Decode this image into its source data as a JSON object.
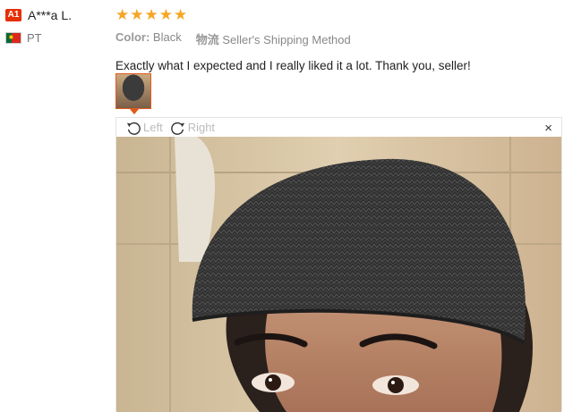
{
  "reviewer": {
    "badge": "A1",
    "name": "A***a L.",
    "country_code": "PT"
  },
  "rating": {
    "stars": 5,
    "max": 5
  },
  "meta": {
    "color_label": "Color:",
    "color_value": "Black",
    "shipping_label": "物流",
    "shipping_value": "Seller's Shipping Method"
  },
  "review_text": "Exactly what I expected and I really liked it a lot. Thank you, seller!",
  "viewer": {
    "rotate_left": "Left",
    "rotate_right": "Right",
    "close": "×"
  },
  "colors": {
    "accent": "#e62e04",
    "star": "#f5a623",
    "thumb_border": "#e05a1b"
  }
}
